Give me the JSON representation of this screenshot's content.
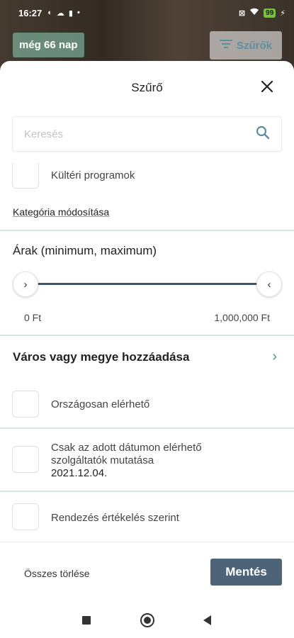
{
  "status_bar": {
    "time": "16:27",
    "battery": "99"
  },
  "background": {
    "days_badge": "még 66 nap",
    "filters_label": "Szűrők"
  },
  "sheet": {
    "title": "Szűrő",
    "search": {
      "placeholder": "Keresés",
      "value": ""
    },
    "outdoor_programs": {
      "label": "Kültéri programok",
      "checked": false
    },
    "category_link": "Kategória módosítása",
    "price": {
      "title": "Árak (minimum, maximum)",
      "min_label": "0 Ft",
      "max_label": "1,000,000 Ft"
    },
    "city": {
      "label": "Város vagy megye hozzáadása"
    },
    "nationwide": {
      "label": "Országosan elérhető",
      "checked": false
    },
    "date_only": {
      "label_line1": "Csak az adott dátumon elérhető",
      "label_line2": "szolgáltatók mutatása",
      "date": "2021.12.04.",
      "checked": false
    },
    "sort_rating": {
      "label": "Rendezés értékelés szerint",
      "checked": false
    },
    "footer": {
      "clear_all": "Összes törlése",
      "save": "Mentés"
    }
  },
  "colors": {
    "accent": "#4d6478",
    "divider": "#d6e6e2",
    "link_teal": "#5a8fa0"
  },
  "icons": {
    "close": "close-icon",
    "search": "search-icon",
    "chevron_right": "chevron-right-icon",
    "filter": "filter-icon"
  }
}
